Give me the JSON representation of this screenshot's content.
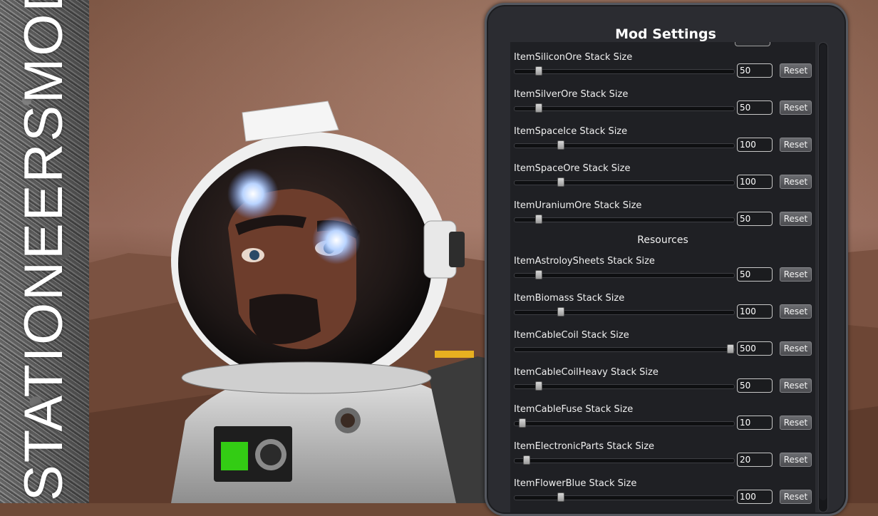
{
  "brand": {
    "text": "STATIONEERSMODS"
  },
  "panel": {
    "title": "Mod Settings",
    "reset_label": "Reset",
    "rows_top": [
      {
        "label": "ItemSiliconOre Stack Size",
        "value": "50",
        "slider": 0.11
      },
      {
        "label": "ItemSilverOre Stack Size",
        "value": "50",
        "slider": 0.11
      },
      {
        "label": "ItemSpaceIce Stack Size",
        "value": "100",
        "slider": 0.21
      },
      {
        "label": "ItemSpaceOre Stack Size",
        "value": "100",
        "slider": 0.21
      },
      {
        "label": "ItemUraniumOre Stack Size",
        "value": "50",
        "slider": 0.11
      }
    ],
    "section": "Resources",
    "rows_bottom": [
      {
        "label": "ItemAstroloySheets Stack Size",
        "value": "50",
        "slider": 0.11
      },
      {
        "label": "ItemBiomass Stack Size",
        "value": "100",
        "slider": 0.21
      },
      {
        "label": "ItemCableCoil Stack Size",
        "value": "500",
        "slider": 0.985
      },
      {
        "label": "ItemCableCoilHeavy Stack Size",
        "value": "50",
        "slider": 0.11
      },
      {
        "label": "ItemCableFuse Stack Size",
        "value": "10",
        "slider": 0.035
      },
      {
        "label": "ItemElectronicParts Stack Size",
        "value": "20",
        "slider": 0.055
      },
      {
        "label": "ItemFlowerBlue Stack Size",
        "value": "100",
        "slider": 0.21
      }
    ]
  }
}
